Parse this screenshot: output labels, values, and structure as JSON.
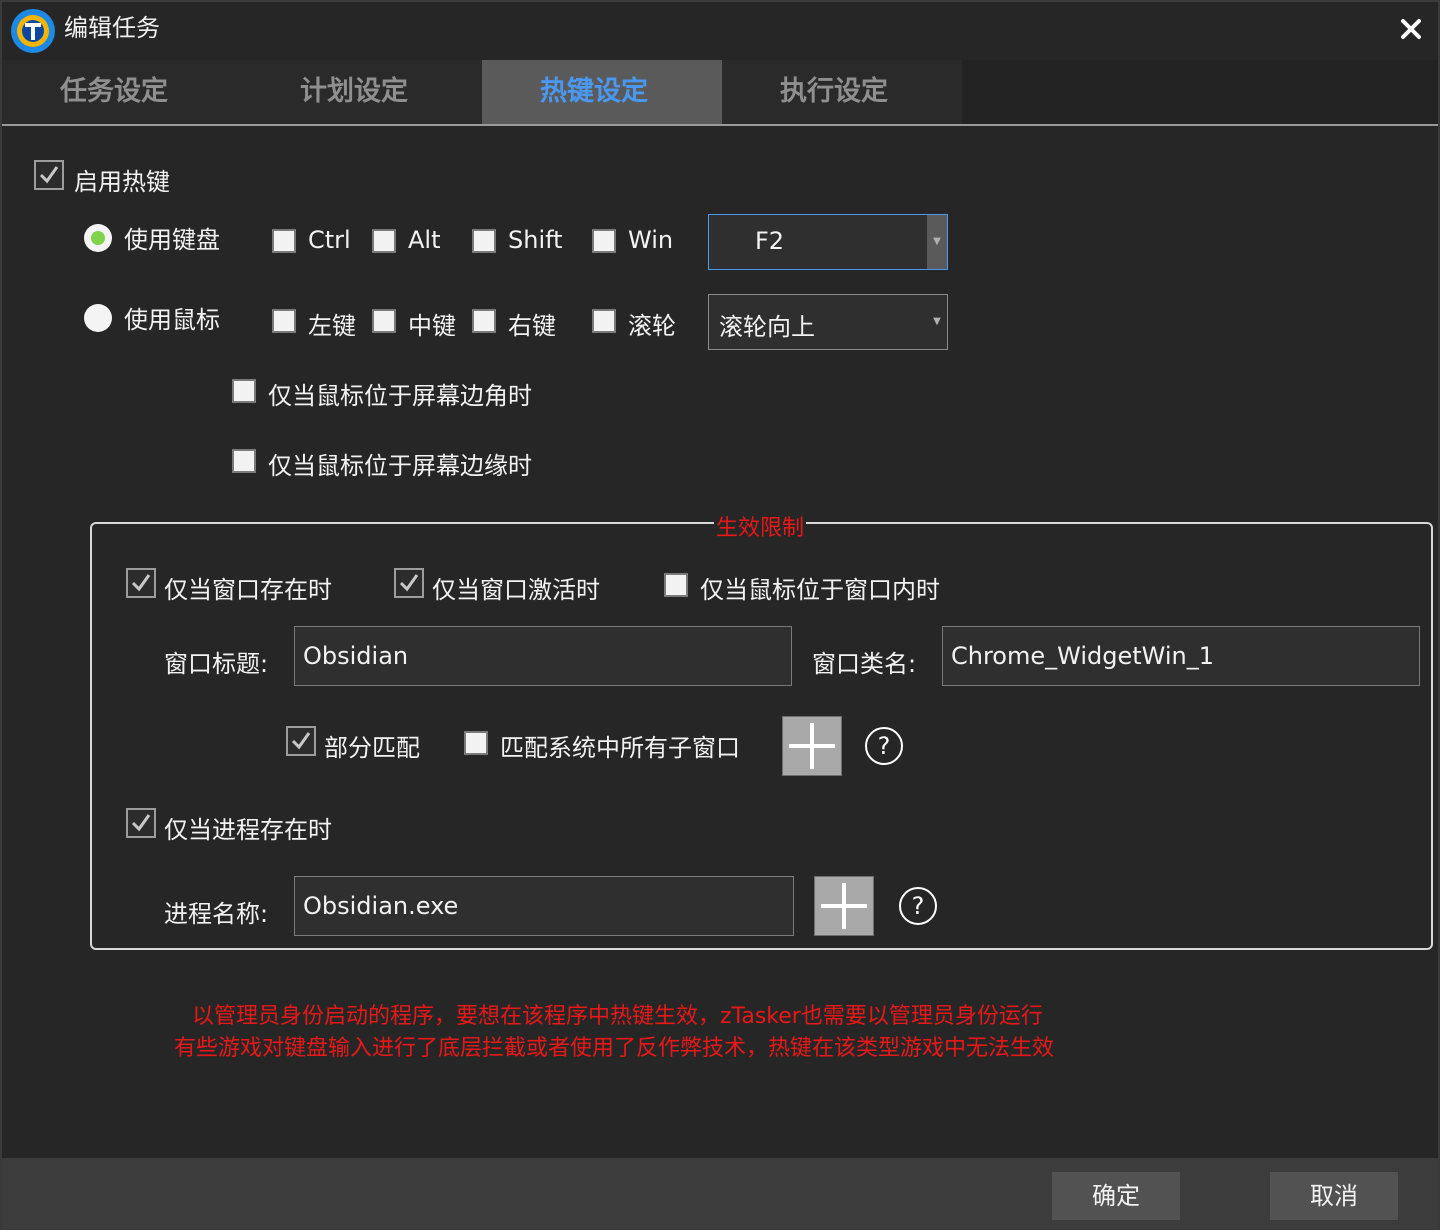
{
  "window": {
    "title": "编辑任务"
  },
  "tabs": [
    {
      "label": "任务设定",
      "active": false
    },
    {
      "label": "计划设定",
      "active": false
    },
    {
      "label": "热键设定",
      "active": true
    },
    {
      "label": "执行设定",
      "active": false
    }
  ],
  "hotkey": {
    "enable_label": "启用热键",
    "enabled": true,
    "keyboard": {
      "radio_label": "使用键盘",
      "selected": true,
      "modifiers": [
        {
          "label": "Ctrl",
          "checked": false
        },
        {
          "label": "Alt",
          "checked": false
        },
        {
          "label": "Shift",
          "checked": false
        },
        {
          "label": "Win",
          "checked": false
        }
      ],
      "key_value": "F2"
    },
    "mouse": {
      "radio_label": "使用鼠标",
      "selected": false,
      "buttons": [
        {
          "label": "左键",
          "checked": false
        },
        {
          "label": "中键",
          "checked": false
        },
        {
          "label": "右键",
          "checked": false
        },
        {
          "label": "滚轮",
          "checked": false
        }
      ],
      "action_value": "滚轮向上",
      "corner_label": "仅当鼠标位于屏幕边角时",
      "edge_label": "仅当鼠标位于屏幕边缘时"
    }
  },
  "restriction": {
    "group_title": "生效限制",
    "window_exists_label": "仅当窗口存在时",
    "window_active_label": "仅当窗口激活时",
    "mouse_in_window_label": "仅当鼠标位于窗口内时",
    "window_title_label": "窗口标题:",
    "window_title_value": "Obsidian",
    "window_class_label": "窗口类名:",
    "window_class_value": "Chrome_WidgetWin_1",
    "partial_match_label": "部分匹配",
    "match_children_label": "匹配系统中所有子窗口",
    "process_exists_label": "仅当进程存在时",
    "process_name_label": "进程名称:",
    "process_name_value": "Obsidian.exe"
  },
  "notes": [
    "以管理员身份启动的程序，要想在该程序中热键生效，zTasker也需要以管理员身份运行",
    "有些游戏对键盘输入进行了底层拦截或者使用了反作弊技术，热键在该类型游戏中无法生效"
  ],
  "footer": {
    "ok_label": "确定",
    "cancel_label": "取消"
  },
  "colors": {
    "accent": "#4a98f0",
    "warning": "#e81818",
    "radio_selected": "#7ed34a"
  }
}
